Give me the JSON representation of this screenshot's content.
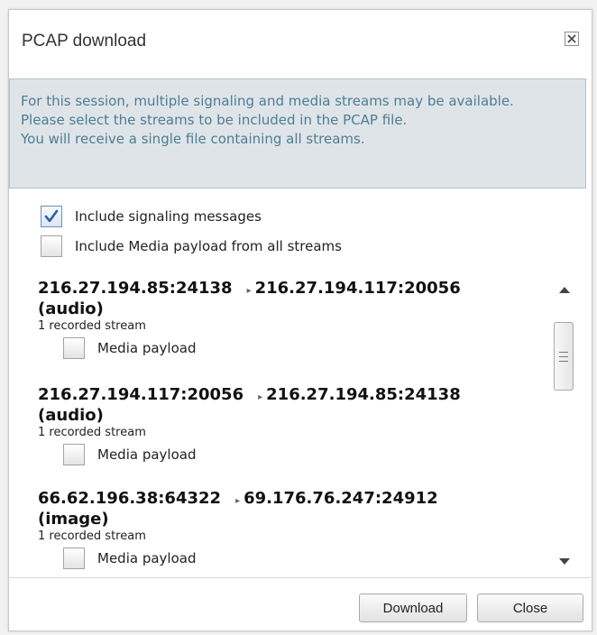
{
  "dialog": {
    "title": "PCAP download",
    "info_lines": [
      "For this session, multiple signaling and media streams may be available.",
      "Please select the streams to be included in the PCAP file.",
      "You will receive a single file containing all streams."
    ],
    "options": [
      {
        "label": "Include signaling messages",
        "checked": true
      },
      {
        "label": "Include Media payload from all streams",
        "checked": false
      }
    ],
    "streams": [
      {
        "source": "216.27.194.85:24138",
        "destination": "216.27.194.117:20056",
        "kind": "(audio)",
        "count": "1 recorded stream",
        "payload_label": "Media payload"
      },
      {
        "source": "216.27.194.117:20056",
        "destination": "216.27.194.85:24138",
        "kind": "(audio)",
        "count": "1 recorded stream",
        "payload_label": "Media payload"
      },
      {
        "source": "66.62.196.38:64322",
        "destination": "69.176.76.247:24912",
        "kind": "(image)",
        "count": "1 recorded stream",
        "payload_label": "Media payload"
      }
    ],
    "buttons": {
      "download": "Download",
      "close": "Close"
    }
  },
  "colors": {
    "info_text": "#4d7e94",
    "info_bg": "#dfe4e8",
    "check": "#2a5fa8"
  },
  "icons": {
    "close": "close-icon",
    "check": "check-icon",
    "arrow": "arrow-icon"
  }
}
